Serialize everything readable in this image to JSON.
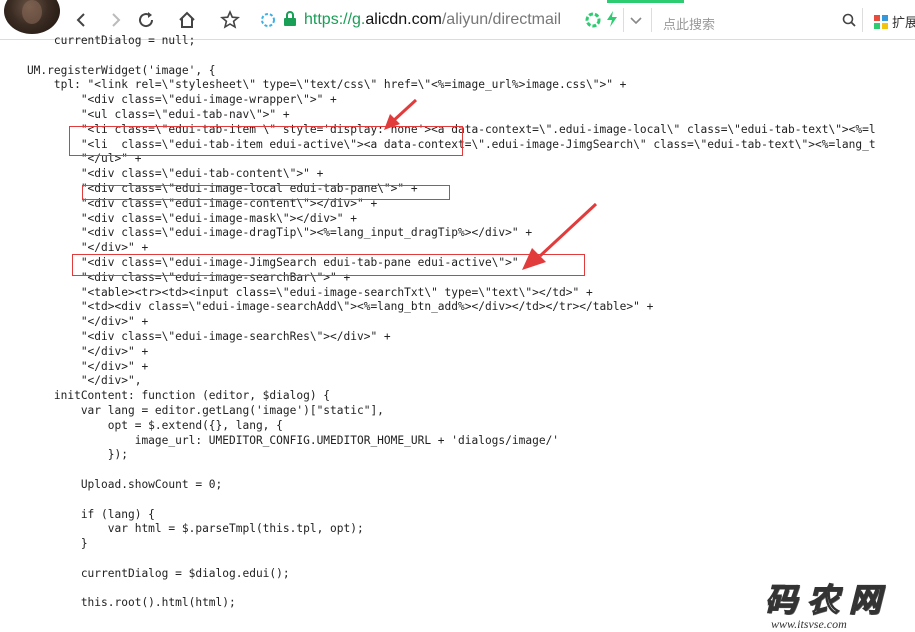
{
  "browser": {
    "url": {
      "scheme": "https://g.",
      "host": "alicdn.com",
      "path": "/aliyun/directmail"
    },
    "search_placeholder": "点此搜索",
    "extensions_label": "扩展"
  },
  "code_lines": [
    "        currentDialog = null;",
    "",
    "    UM.registerWidget('image', {",
    "        tpl: \"<link rel=\\\"stylesheet\\\" type=\\\"text/css\\\" href=\\\"<%=image_url%>image.css\\\">\" +",
    "            \"<div class=\\\"edui-image-wrapper\\\">\" +",
    "            \"<ul class=\\\"edui-tab-nav\\\">\" +",
    "            \"<li class=\\\"edui-tab-item \\\" style='display: none'><a data-context=\\\".edui-image-local\\\" class=\\\"edui-tab-text\\\"><%=l",
    "            \"<li  class=\\\"edui-tab-item edui-active\\\"><a data-context=\\\".edui-image-JimgSearch\\\" class=\\\"edui-tab-text\\\"><%=lang_t",
    "            \"</ul>\" +",
    "            \"<div class=\\\"edui-tab-content\\\">\" +",
    "            \"<div class=\\\"edui-image-local edui-tab-pane\\\">\" +",
    "            \"<div class=\\\"edui-image-content\\\"></div>\" +",
    "            \"<div class=\\\"edui-image-mask\\\"></div>\" +",
    "            \"<div class=\\\"edui-image-dragTip\\\"><%=lang_input_dragTip%></div>\" +",
    "            \"</div>\" +",
    "            \"<div class=\\\"edui-image-JimgSearch edui-tab-pane edui-active\\\">\" +",
    "            \"<div class=\\\"edui-image-searchBar\\\">\" +",
    "            \"<table><tr><td><input class=\\\"edui-image-searchTxt\\\" type=\\\"text\\\"></td>\" +",
    "            \"<td><div class=\\\"edui-image-searchAdd\\\"><%=lang_btn_add%></div></td></tr></table>\" +",
    "            \"</div>\" +",
    "            \"<div class=\\\"edui-image-searchRes\\\"></div>\" +",
    "            \"</div>\" +",
    "            \"</div>\" +",
    "            \"</div>\",",
    "        initContent: function (editor, $dialog) {",
    "            var lang = editor.getLang('image')[\"static\"],",
    "                opt = $.extend({}, lang, {",
    "                    image_url: UMEDITOR_CONFIG.UMEDITOR_HOME_URL + 'dialogs/image/'",
    "                });",
    "",
    "            Upload.showCount = 0;",
    "",
    "            if (lang) {",
    "                var html = $.parseTmpl(this.tpl, opt);",
    "            }",
    "",
    "            currentDialog = $dialog.edui();",
    "",
    "            this.root().html(html);"
  ],
  "watermark": {
    "logo_text": "码农网",
    "site_url": "www.itsvse.com"
  },
  "colors": {
    "url_green": "#1a9f57",
    "annotation_red": "#e23b3b",
    "tab_accent": "#2ecc71"
  }
}
